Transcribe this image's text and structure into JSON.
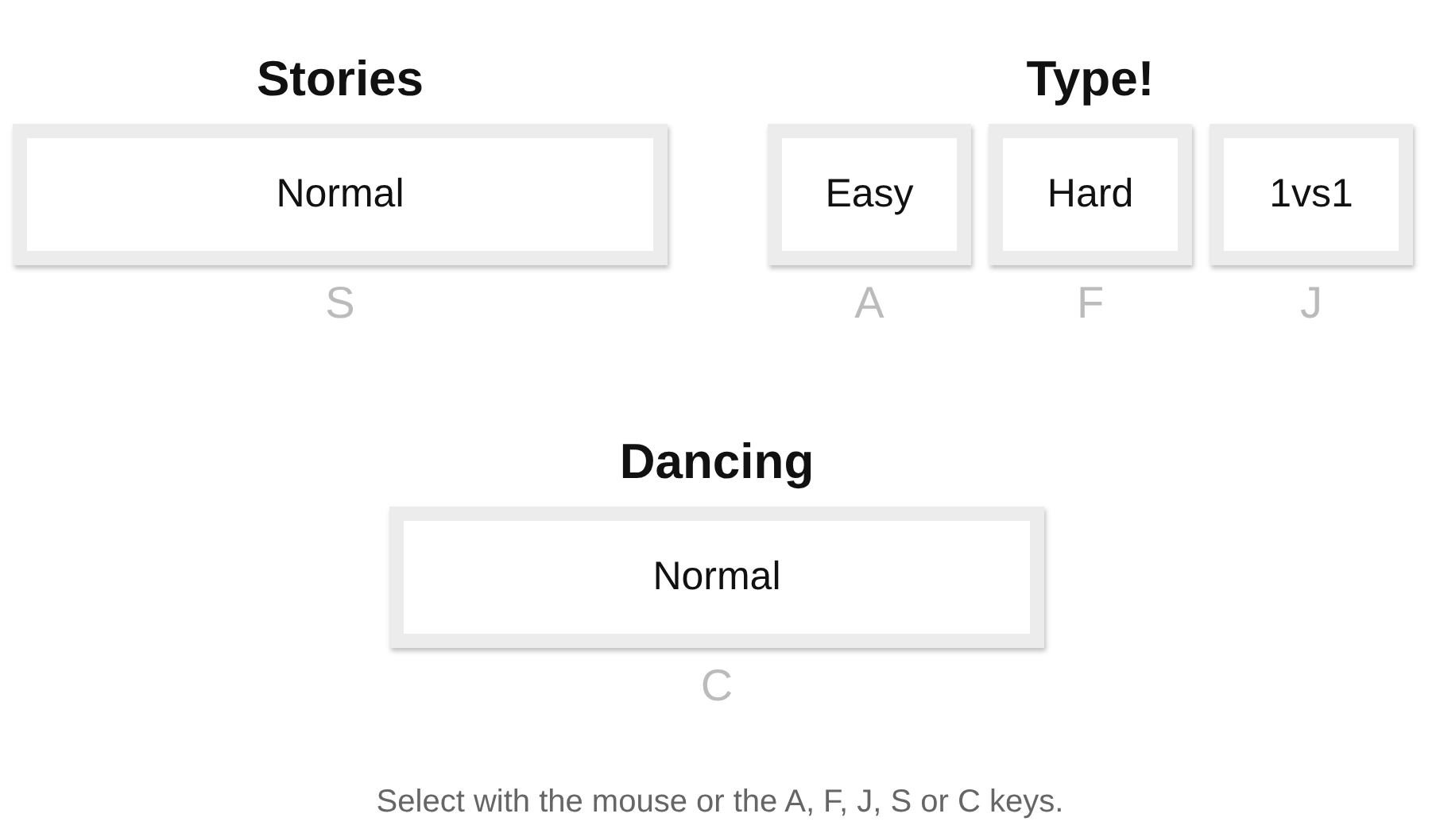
{
  "rows": [
    [
      {
        "title": "Stories",
        "modes": [
          {
            "label": "Normal",
            "key": "S"
          }
        ]
      },
      {
        "title": "Type!",
        "modes": [
          {
            "label": "Easy",
            "key": "A"
          },
          {
            "label": "Hard",
            "key": "F"
          },
          {
            "label": "1vs1",
            "key": "J"
          }
        ]
      }
    ],
    [
      {
        "title": "Dancing",
        "modes": [
          {
            "label": "Normal",
            "key": "C"
          }
        ]
      }
    ]
  ],
  "instructions": "Select with the mouse or the A, F, J, S or C keys."
}
